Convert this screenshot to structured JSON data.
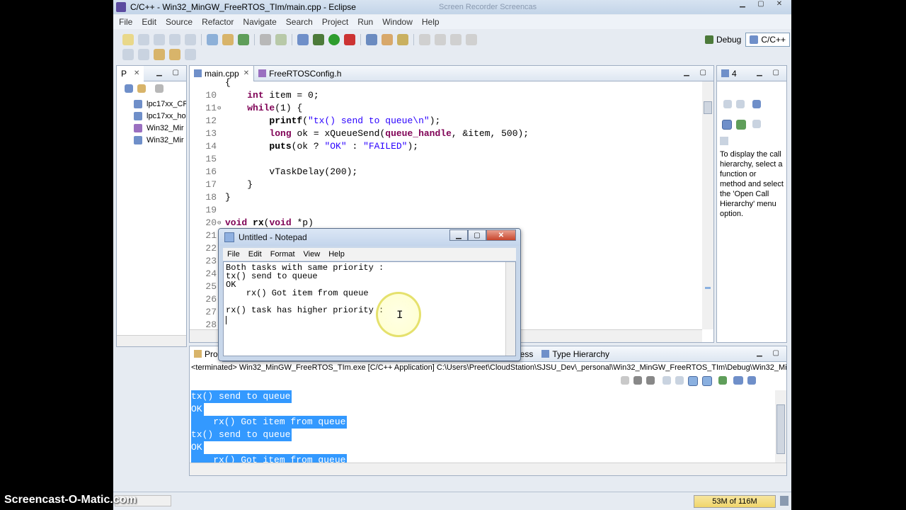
{
  "window": {
    "title": "C/C++ - Win32_MinGW_FreeRTOS_TIm/main.cpp - Eclipse",
    "faded_title": "Screen Recorder Screencas"
  },
  "menu": [
    "File",
    "Edit",
    "Source",
    "Refactor",
    "Navigate",
    "Search",
    "Project",
    "Run",
    "Window",
    "Help"
  ],
  "perspectives": [
    {
      "label": "Debug",
      "active": false
    },
    {
      "label": "C/C++",
      "active": true
    }
  ],
  "project_explorer": {
    "tab_label": "P",
    "items": [
      "lpc17xx_CP",
      "lpc17xx_ho",
      "Win32_Mir",
      "Win32_Mir"
    ]
  },
  "editor": {
    "tabs": [
      {
        "label": "main.cpp",
        "active": true
      },
      {
        "label": "FreeRTOSConfig.h",
        "active": false
      }
    ],
    "top_partial": "{",
    "lines": [
      {
        "num": "10",
        "fold": "",
        "text": "    int item = 0;"
      },
      {
        "num": "11",
        "fold": "⊖",
        "text": "    while(1) {"
      },
      {
        "num": "12",
        "fold": "",
        "text": "        printf(\"tx() send to queue\\n\");"
      },
      {
        "num": "13",
        "fold": "",
        "text": "        long ok = xQueueSend(queue_handle, &item, 500);"
      },
      {
        "num": "14",
        "fold": "",
        "text": "        puts(ok ? \"OK\" : \"FAILED\");"
      },
      {
        "num": "15",
        "fold": "",
        "text": ""
      },
      {
        "num": "16",
        "fold": "",
        "text": "        vTaskDelay(200);"
      },
      {
        "num": "17",
        "fold": "",
        "text": "    }"
      },
      {
        "num": "18",
        "fold": "",
        "text": "}"
      },
      {
        "num": "19",
        "fold": "",
        "text": ""
      },
      {
        "num": "20",
        "fold": "⊖",
        "text": "void rx(void *p)"
      },
      {
        "num": "21",
        "fold": "",
        "text": ""
      },
      {
        "num": "22",
        "fold": "",
        "text": ""
      },
      {
        "num": "23",
        "fold": "",
        "text": ""
      },
      {
        "num": "24",
        "fold": "",
        "text": ""
      },
      {
        "num": "25",
        "fold": "",
        "text": ""
      },
      {
        "num": "26",
        "fold": "",
        "text": ""
      },
      {
        "num": "27",
        "fold": "",
        "text": ""
      },
      {
        "num": "28",
        "fold": "",
        "text": ""
      }
    ],
    "peek_24": ")) {",
    "peek_25": "\");"
  },
  "call_hierarchy": {
    "tab_label": "4",
    "message": "To display the call hierarchy, select a function or method and select the 'Open Call Hierarchy' menu option."
  },
  "console": {
    "tabs": [
      "Pro",
      "ress",
      "Type Hierarchy"
    ],
    "header": "<terminated> Win32_MinGW_FreeRTOS_TIm.exe [C/C++ Application] C:\\Users\\Preet\\CloudStation\\SJSU_Dev\\_personal\\Win32_MinGW_FreeRTOS_TIm\\Debug\\Win32_Mir",
    "lines": [
      "tx() send to queue",
      "OK",
      "    rx() Got item from queue",
      "tx() send to queue",
      "OK",
      "    rx() Got item from queue"
    ]
  },
  "notepad": {
    "title": "Untitled - Notepad",
    "menu": [
      "File",
      "Edit",
      "Format",
      "View",
      "Help"
    ],
    "lines": [
      "Both tasks with same priority :",
      "tx() send to queue",
      "OK",
      "    rx() Got item from queue",
      "",
      "rx() task has higher priority :",
      ""
    ]
  },
  "status": {
    "heap": "53M of 116M"
  },
  "watermark": "Screencast-O-Matic.com"
}
